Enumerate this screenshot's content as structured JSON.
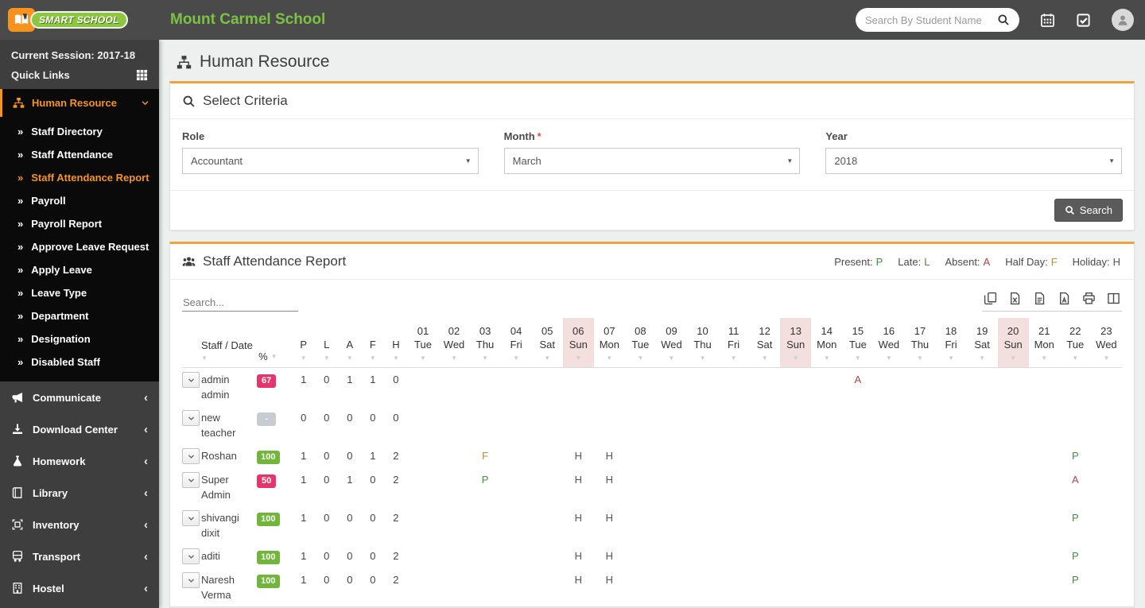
{
  "app": {
    "logo_text": "SMART SCHOOL",
    "school_name": "Mount Carmel School"
  },
  "topbar": {
    "search_placeholder": "Search By Student Name"
  },
  "sidebar": {
    "session_label": "Current Session: 2017-18",
    "quick_links_label": "Quick Links",
    "active_menu": "Human Resource",
    "submenu": [
      {
        "label": "Staff Directory",
        "active": false
      },
      {
        "label": "Staff Attendance",
        "active": false
      },
      {
        "label": "Staff Attendance Report",
        "active": true
      },
      {
        "label": "Payroll",
        "active": false
      },
      {
        "label": "Payroll Report",
        "active": false
      },
      {
        "label": "Approve Leave Request",
        "active": false
      },
      {
        "label": "Apply Leave",
        "active": false
      },
      {
        "label": "Leave Type",
        "active": false
      },
      {
        "label": "Department",
        "active": false
      },
      {
        "label": "Designation",
        "active": false
      },
      {
        "label": "Disabled Staff",
        "active": false
      }
    ],
    "menus": [
      {
        "label": "Communicate",
        "icon": "megaphone-icon"
      },
      {
        "label": "Download Center",
        "icon": "download-icon"
      },
      {
        "label": "Homework",
        "icon": "flask-icon"
      },
      {
        "label": "Library",
        "icon": "book-icon"
      },
      {
        "label": "Inventory",
        "icon": "box-icon"
      },
      {
        "label": "Transport",
        "icon": "bus-icon"
      },
      {
        "label": "Hostel",
        "icon": "building-icon"
      }
    ]
  },
  "page": {
    "title": "Human Resource"
  },
  "criteria": {
    "title": "Select Criteria",
    "fields": [
      {
        "label": "Role",
        "required": false,
        "value": "Accountant"
      },
      {
        "label": "Month",
        "required": true,
        "value": "March"
      },
      {
        "label": "Year",
        "required": false,
        "value": "2018"
      }
    ],
    "search_button": "Search"
  },
  "report": {
    "title": "Staff Attendance Report",
    "legend": [
      {
        "label": "Present:",
        "code": "P"
      },
      {
        "label": "Late:",
        "code": "L"
      },
      {
        "label": "Absent:",
        "code": "A"
      },
      {
        "label": "Half Day:",
        "code": "F"
      },
      {
        "label": "Holiday:",
        "code": "H"
      }
    ],
    "search_placeholder": "Search...",
    "export_tools": [
      "copy-icon",
      "excel-icon",
      "file-text-icon",
      "pdf-icon",
      "print-icon",
      "columns-icon"
    ],
    "table": {
      "staff_header": "Staff / Date",
      "percent_header": "%",
      "summary_headers": [
        "P",
        "L",
        "A",
        "F",
        "H"
      ],
      "dates": [
        {
          "day": "01",
          "weekday": "Tue",
          "sunday": false
        },
        {
          "day": "02",
          "weekday": "Wed",
          "sunday": false
        },
        {
          "day": "03",
          "weekday": "Thu",
          "sunday": false
        },
        {
          "day": "04",
          "weekday": "Fri",
          "sunday": false
        },
        {
          "day": "05",
          "weekday": "Sat",
          "sunday": false
        },
        {
          "day": "06",
          "weekday": "Sun",
          "sunday": true
        },
        {
          "day": "07",
          "weekday": "Mon",
          "sunday": false
        },
        {
          "day": "08",
          "weekday": "Tue",
          "sunday": false
        },
        {
          "day": "09",
          "weekday": "Wed",
          "sunday": false
        },
        {
          "day": "10",
          "weekday": "Thu",
          "sunday": false
        },
        {
          "day": "11",
          "weekday": "Fri",
          "sunday": false
        },
        {
          "day": "12",
          "weekday": "Sat",
          "sunday": false
        },
        {
          "day": "13",
          "weekday": "Sun",
          "sunday": true
        },
        {
          "day": "14",
          "weekday": "Mon",
          "sunday": false
        },
        {
          "day": "15",
          "weekday": "Tue",
          "sunday": false
        },
        {
          "day": "16",
          "weekday": "Wed",
          "sunday": false
        },
        {
          "day": "17",
          "weekday": "Thu",
          "sunday": false
        },
        {
          "day": "18",
          "weekday": "Fri",
          "sunday": false
        },
        {
          "day": "19",
          "weekday": "Sat",
          "sunday": false
        },
        {
          "day": "20",
          "weekday": "Sun",
          "sunday": true
        },
        {
          "day": "21",
          "weekday": "Mon",
          "sunday": false
        },
        {
          "day": "22",
          "weekday": "Tue",
          "sunday": false
        },
        {
          "day": "23",
          "weekday": "Wed",
          "sunday": false
        }
      ],
      "rows": [
        {
          "name": "admin admin",
          "percent": "67",
          "percent_style": "danger",
          "summary": [
            "1",
            "0",
            "1",
            "1",
            "0"
          ],
          "marks": {
            "15": "A"
          }
        },
        {
          "name": "new teacher",
          "percent": "-",
          "percent_style": "muted",
          "summary": [
            "0",
            "0",
            "0",
            "0",
            "0"
          ],
          "marks": {}
        },
        {
          "name": "Roshan",
          "percent": "100",
          "percent_style": "success",
          "summary": [
            "1",
            "0",
            "0",
            "1",
            "2"
          ],
          "marks": {
            "03": "F",
            "06": "H",
            "07": "H",
            "22": "P"
          }
        },
        {
          "name": "Super Admin",
          "percent": "50",
          "percent_style": "danger",
          "summary": [
            "1",
            "0",
            "1",
            "0",
            "2"
          ],
          "marks": {
            "03": "P",
            "06": "H",
            "07": "H",
            "22": "A"
          }
        },
        {
          "name": "shivangi dixit",
          "percent": "100",
          "percent_style": "success",
          "summary": [
            "1",
            "0",
            "0",
            "0",
            "2"
          ],
          "marks": {
            "06": "H",
            "07": "H",
            "22": "P"
          }
        },
        {
          "name": "aditi",
          "percent": "100",
          "percent_style": "success",
          "summary": [
            "1",
            "0",
            "0",
            "0",
            "2"
          ],
          "marks": {
            "06": "H",
            "07": "H",
            "22": "P"
          }
        },
        {
          "name": "Naresh Verma",
          "percent": "100",
          "percent_style": "success",
          "summary": [
            "1",
            "0",
            "0",
            "0",
            "2"
          ],
          "marks": {
            "06": "H",
            "07": "H",
            "22": "P"
          }
        }
      ]
    }
  },
  "colors": {
    "accent_orange": "#f7941d",
    "brand_green": "#7cc242",
    "card_top_border": "#f0a33c",
    "sunday_header_bg": "#f4dfdf",
    "badge_danger": "#e7356b",
    "badge_success": "#71b53b",
    "badge_muted": "#c6ccd2",
    "marks": {
      "P": "#3f8f44",
      "L": "#8a6d3b",
      "A": "#a94442",
      "F": "#c18a2c",
      "H": "#555555"
    }
  }
}
